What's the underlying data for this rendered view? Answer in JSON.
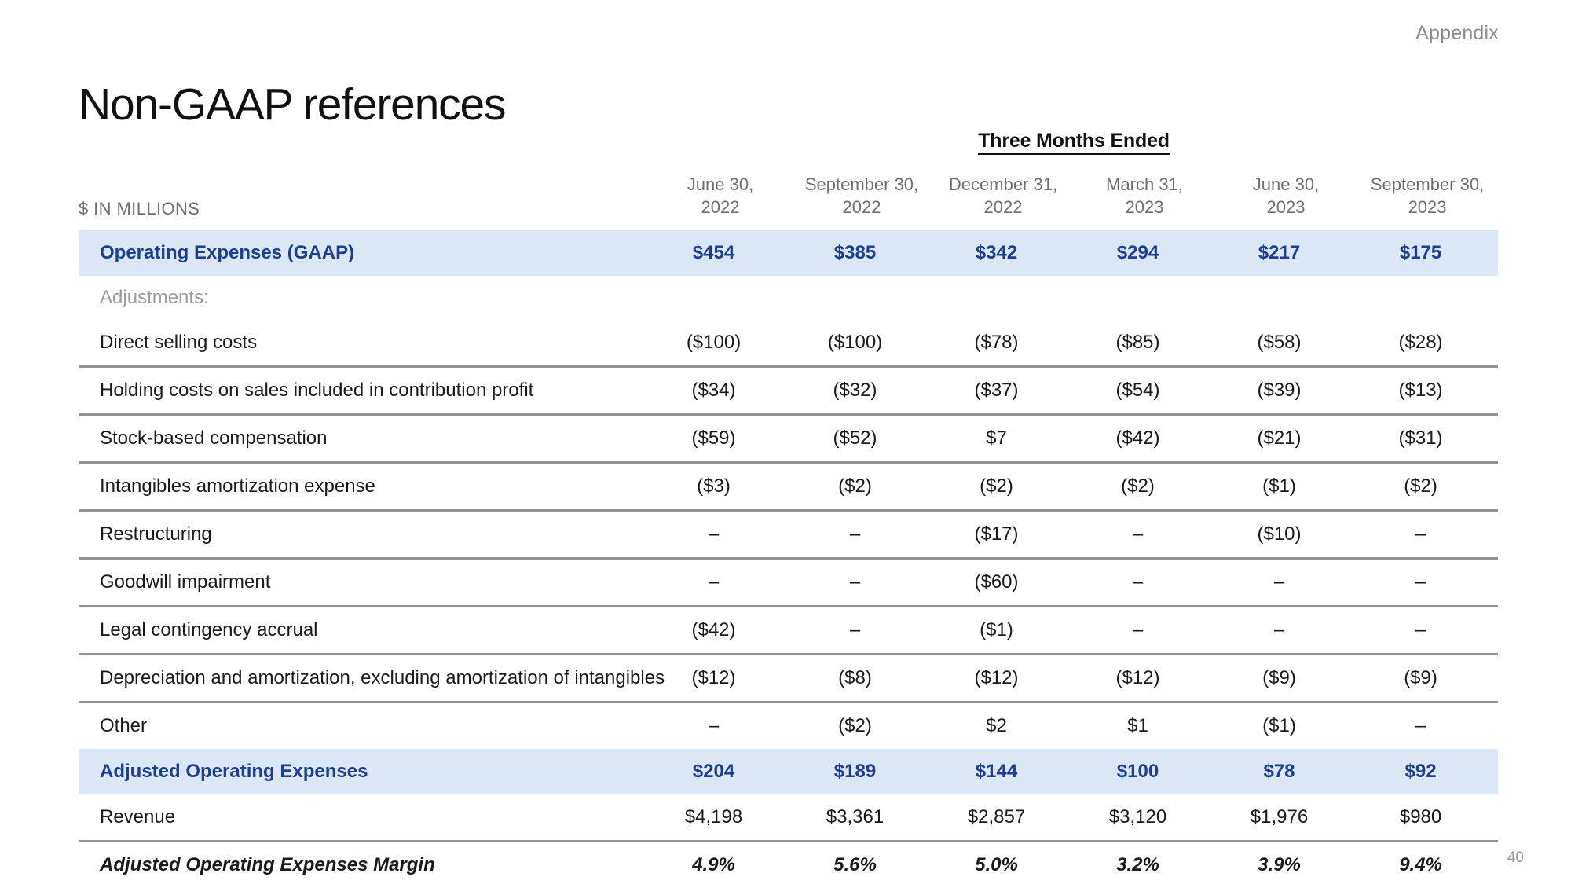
{
  "slide": {
    "appendix_label": "Appendix",
    "title": "Non-GAAP references",
    "page_number": "40"
  },
  "table": {
    "span_header": "Three Months Ended",
    "units_label": "$ IN MILLIONS",
    "columns": [
      {
        "month": "June 30,",
        "year": "2022"
      },
      {
        "month": "September 30,",
        "year": "2022"
      },
      {
        "month": "December 31,",
        "year": "2022"
      },
      {
        "month": "March 31,",
        "year": "2023"
      },
      {
        "month": "June 30,",
        "year": "2023"
      },
      {
        "month": "September 30,",
        "year": "2023"
      }
    ],
    "adjustments_label": "Adjustments:",
    "rows": [
      {
        "label": "Operating Expenses (GAAP)",
        "values": [
          "$454",
          "$385",
          "$342",
          "$294",
          "$217",
          "$175"
        ]
      },
      {
        "label": "Direct selling costs",
        "values": [
          "($100)",
          "($100)",
          "($78)",
          "($85)",
          "($58)",
          "($28)"
        ]
      },
      {
        "label": "Holding costs on sales included in contribution profit",
        "values": [
          "($34)",
          "($32)",
          "($37)",
          "($54)",
          "($39)",
          "($13)"
        ]
      },
      {
        "label": "Stock-based compensation",
        "values": [
          "($59)",
          "($52)",
          "$7",
          "($42)",
          "($21)",
          "($31)"
        ]
      },
      {
        "label": "Intangibles amortization expense",
        "values": [
          "($3)",
          "($2)",
          "($2)",
          "($2)",
          "($1)",
          "($2)"
        ]
      },
      {
        "label": "Restructuring",
        "values": [
          "–",
          "–",
          "($17)",
          "–",
          "($10)",
          "–"
        ]
      },
      {
        "label": "Goodwill impairment",
        "values": [
          "–",
          "–",
          "($60)",
          "–",
          "–",
          "–"
        ]
      },
      {
        "label": "Legal contingency accrual",
        "values": [
          "($42)",
          "–",
          "($1)",
          "–",
          "–",
          "–"
        ]
      },
      {
        "label": "Depreciation and amortization, excluding amortization of intangibles",
        "values": [
          "($12)",
          "($8)",
          "($12)",
          "($12)",
          "($9)",
          "($9)"
        ]
      },
      {
        "label": "Other",
        "values": [
          "–",
          "($2)",
          "$2",
          "$1",
          "($1)",
          "–"
        ]
      },
      {
        "label": "Adjusted Operating Expenses",
        "values": [
          "$204",
          "$189",
          "$144",
          "$100",
          "$78",
          "$92"
        ]
      },
      {
        "label": "Revenue",
        "values": [
          "$4,198",
          "$3,361",
          "$2,857",
          "$3,120",
          "$1,976",
          "$980"
        ]
      },
      {
        "label": "Adjusted Operating Expenses Margin",
        "values": [
          "4.9%",
          "5.6%",
          "5.0%",
          "3.2%",
          "3.9%",
          "9.4%"
        ]
      }
    ]
  },
  "colors": {
    "highlight_bg": "#dce7f6",
    "highlight_text": "#1b3f91",
    "rule": "#939393",
    "muted_text": "#9b9b9b",
    "header_text": "#6f6f6f"
  }
}
